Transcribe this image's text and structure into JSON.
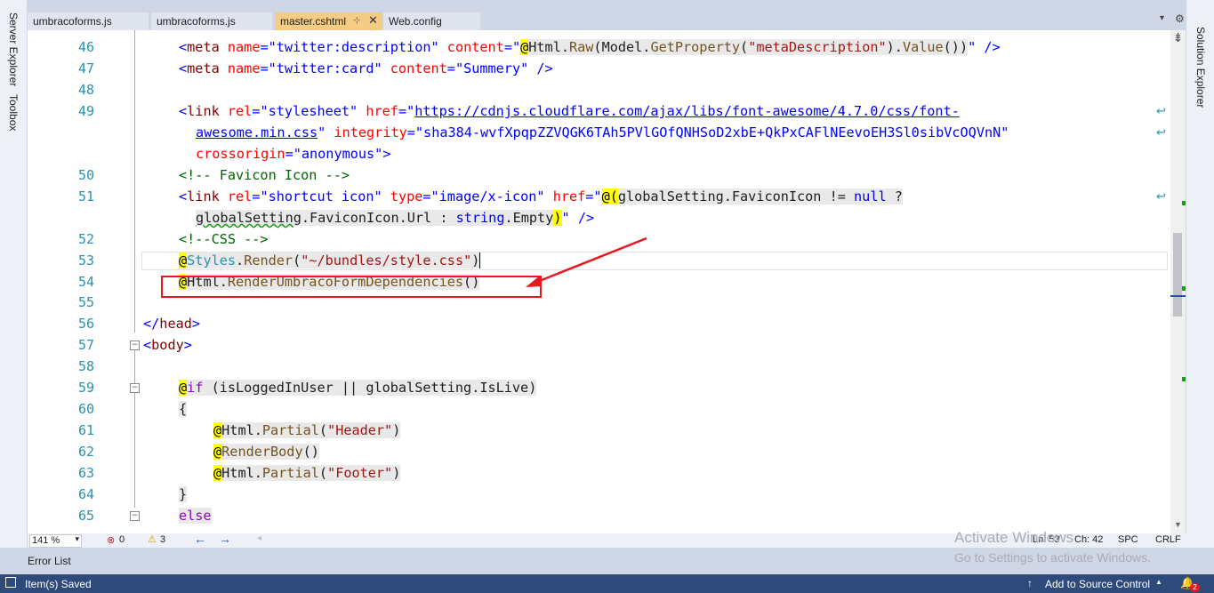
{
  "left_rail": {
    "items": [
      "Server Explorer",
      "Toolbox"
    ]
  },
  "right_rail": {
    "items": [
      "Solution Explorer"
    ]
  },
  "tabs": [
    {
      "label": "umbracoforms.js",
      "active": false
    },
    {
      "label": "umbracoforms.js",
      "active": false
    },
    {
      "label": "master.cshtml",
      "active": true,
      "pin": "⊹",
      "close": "✕"
    },
    {
      "label": "Web.config",
      "active": false
    }
  ],
  "tab_menu": {
    "dropdown": "▾",
    "settings": "⚙"
  },
  "code": {
    "line_46": "46",
    "line_47": "47",
    "line_48": "48",
    "line_49": "49",
    "line_50": "50",
    "line_51": "51",
    "line_52": "52",
    "line_53": "53",
    "line_54": "54",
    "line_55": "55",
    "line_56": "56",
    "line_57": "57",
    "line_58": "58",
    "line_59": "59",
    "line_60": "60",
    "line_61": "61",
    "line_62": "62",
    "line_63": "63",
    "line_64": "64",
    "line_65": "65"
  },
  "editor_status": {
    "zoom": "141 %",
    "errors": "0",
    "warnings": "3",
    "ln": "Ln: 53",
    "ch": "Ch: 42",
    "spc": "SPC",
    "crlf": "CRLF"
  },
  "bottom_panel": {
    "error_list": "Error List"
  },
  "statusbar": {
    "saved": "Item(s) Saved",
    "source_control": "Add to Source Control",
    "notifications": "2"
  },
  "watermark": {
    "title": "Activate Windows",
    "subtitle": "Go to Settings to activate Windows."
  },
  "colors": {
    "accent": "#f5cc84",
    "statusbar": "#2d4a7b",
    "annotation": "#e8191e"
  }
}
